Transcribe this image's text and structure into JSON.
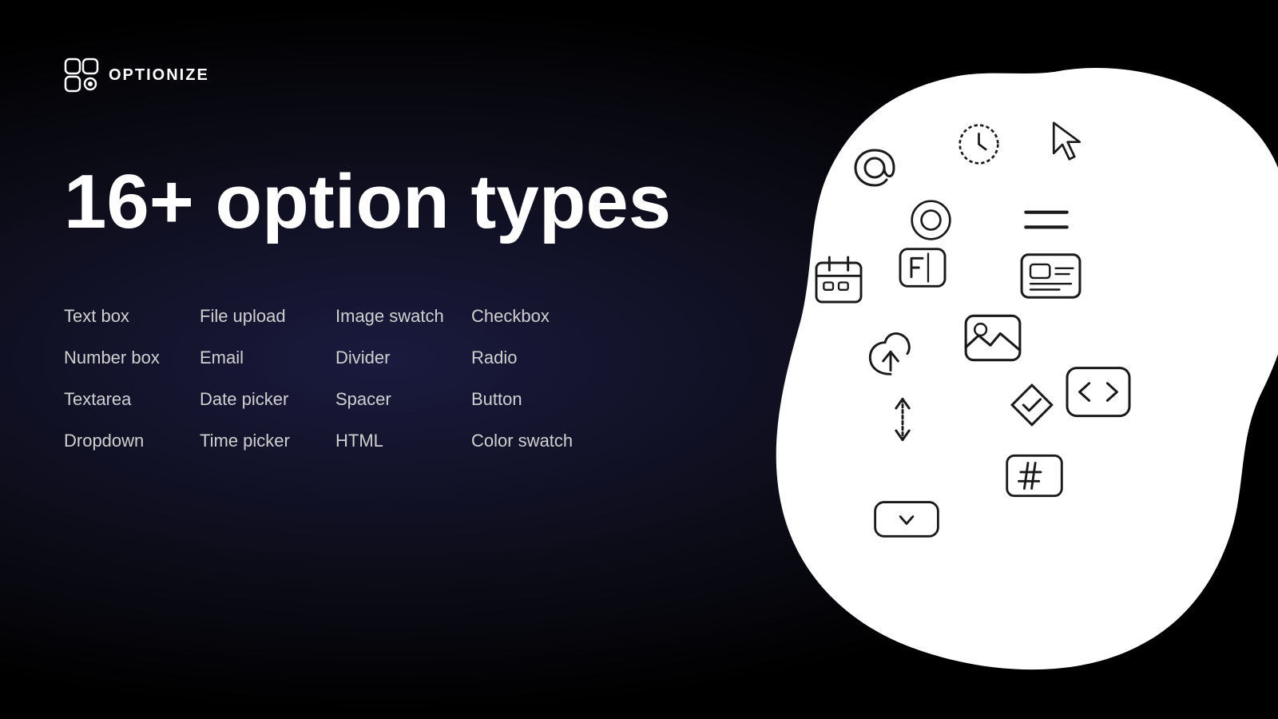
{
  "logo": {
    "text": "OPTIONIZE"
  },
  "heading": "16+ option types",
  "options": [
    [
      "Text box",
      "File upload",
      "Image swatch",
      "Checkbox"
    ],
    [
      "Number box",
      "Email",
      "Divider",
      "Radio"
    ],
    [
      "Textarea",
      "Date picker",
      "Spacer",
      "Button"
    ],
    [
      "Dropdown",
      "Time picker",
      "HTML",
      "Color swatch"
    ]
  ],
  "colors": {
    "background": "#000000",
    "gradient_center": "#1a1a3e",
    "text": "#ffffff",
    "option_text": "#d0d0d0",
    "blob": "#ffffff",
    "icon_stroke": "#111111"
  }
}
